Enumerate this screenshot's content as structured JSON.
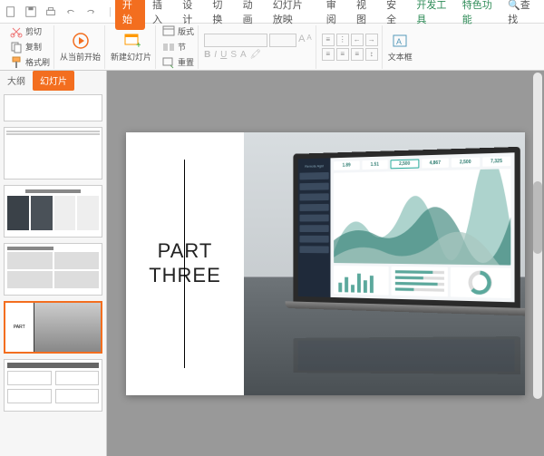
{
  "menubar": {
    "tabs": [
      "开始",
      "插入",
      "设计",
      "切换",
      "动画",
      "幻灯片放映",
      "审阅",
      "视图",
      "安全",
      "开发工具",
      "特色功能"
    ],
    "active_index": 0,
    "search_label": "查找"
  },
  "ribbon": {
    "cut": "剪切",
    "copy": "复制",
    "format_painter": "格式刷",
    "start_from_current": "从当前开始",
    "new_slide": "新建幻灯片",
    "layout": "版式",
    "section": "节",
    "reset": "重置",
    "font_size_dec": "A",
    "font_size_inc": "A",
    "textbox": "文本框"
  },
  "sidepanel": {
    "tabs": [
      "大纲",
      "幻灯片"
    ],
    "active_index": 1
  },
  "slide": {
    "title_line1": "PART",
    "title_line2": "THREE",
    "dashboard": {
      "brand": "Remote Agst",
      "stats": [
        "1.89",
        "1.51",
        "2,500",
        "4,867",
        "2,500",
        "7,325"
      ]
    }
  }
}
